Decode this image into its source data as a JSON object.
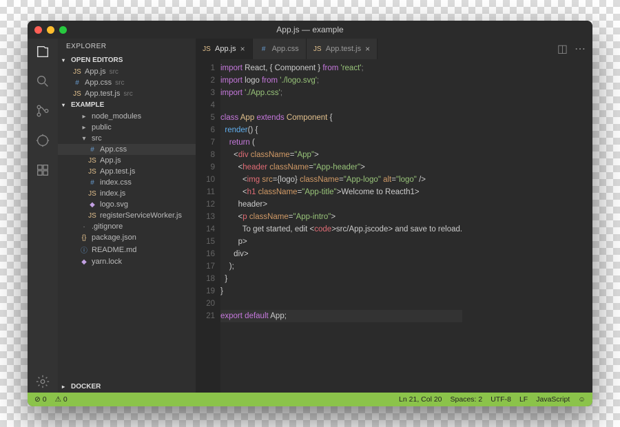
{
  "title": "App.js — example",
  "sidebar": {
    "title": "EXPLORER",
    "open_editors": {
      "label": "OPEN EDITORS",
      "items": [
        {
          "icon": "JS",
          "cls": "js",
          "name": "App.js",
          "meta": "src"
        },
        {
          "icon": "#",
          "cls": "css",
          "name": "App.css",
          "meta": "src"
        },
        {
          "icon": "JS",
          "cls": "js",
          "name": "App.test.js",
          "meta": "src"
        }
      ]
    },
    "project": {
      "label": "EXAMPLE",
      "tree": [
        {
          "icon": "▸",
          "cls": "txt",
          "name": "node_modules",
          "ind": "sub"
        },
        {
          "icon": "▸",
          "cls": "txt",
          "name": "public",
          "ind": "sub"
        },
        {
          "icon": "▾",
          "cls": "txt",
          "name": "src",
          "ind": "sub"
        },
        {
          "icon": "#",
          "cls": "css",
          "name": "App.css",
          "ind": "sub2",
          "sel": true
        },
        {
          "icon": "JS",
          "cls": "js",
          "name": "App.js",
          "ind": "sub2"
        },
        {
          "icon": "JS",
          "cls": "js",
          "name": "App.test.js",
          "ind": "sub2"
        },
        {
          "icon": "#",
          "cls": "css",
          "name": "index.css",
          "ind": "sub2"
        },
        {
          "icon": "JS",
          "cls": "js",
          "name": "index.js",
          "ind": "sub2"
        },
        {
          "icon": "◆",
          "cls": "svg",
          "name": "logo.svg",
          "ind": "sub2"
        },
        {
          "icon": "JS",
          "cls": "js",
          "name": "registerServiceWorker.js",
          "ind": "sub2"
        },
        {
          "icon": "·",
          "cls": "txt",
          "name": ".gitignore",
          "ind": "sub"
        },
        {
          "icon": "{}",
          "cls": "json",
          "name": "package.json",
          "ind": "sub"
        },
        {
          "icon": "ⓘ",
          "cls": "md",
          "name": "README.md",
          "ind": "sub"
        },
        {
          "icon": "◆",
          "cls": "svg",
          "name": "yarn.lock",
          "ind": "sub"
        }
      ]
    },
    "docker": "DOCKER"
  },
  "tabs": [
    {
      "icon": "JS",
      "cls": "js",
      "name": "App.js",
      "close": true,
      "active": true
    },
    {
      "icon": "#",
      "cls": "css",
      "name": "App.css",
      "close": false
    },
    {
      "icon": "JS",
      "cls": "js",
      "name": "App.test.js",
      "close": true
    }
  ],
  "code": {
    "lines": [
      [
        [
          "kw",
          "import"
        ],
        [
          "",
          " React, { Component } "
        ],
        [
          "kw",
          "from"
        ],
        [
          "",
          " "
        ],
        [
          "str",
          "'react'"
        ],
        [
          "pn",
          ";"
        ]
      ],
      [
        [
          "kw",
          "import"
        ],
        [
          "",
          " logo "
        ],
        [
          "kw",
          "from"
        ],
        [
          "",
          " "
        ],
        [
          "str",
          "'./logo.svg'"
        ],
        [
          "pn",
          ";"
        ]
      ],
      [
        [
          "kw",
          "import"
        ],
        [
          "",
          " "
        ],
        [
          "str",
          "'./App.css'"
        ],
        [
          "pn",
          ";"
        ]
      ],
      [],
      [
        [
          "kw",
          "class"
        ],
        [
          "",
          " "
        ],
        [
          "cmp",
          "App"
        ],
        [
          "",
          " "
        ],
        [
          "kw",
          "extends"
        ],
        [
          "",
          " "
        ],
        [
          "cmp",
          "Component"
        ],
        [
          "",
          " {"
        ]
      ],
      [
        [
          "",
          "  "
        ],
        [
          "fn",
          "render"
        ],
        [
          "",
          "() {"
        ]
      ],
      [
        [
          "",
          "    "
        ],
        [
          "kw",
          "return"
        ],
        [
          "",
          " ("
        ]
      ],
      [
        [
          "",
          "      <"
        ],
        [
          "tag",
          "div"
        ],
        [
          "",
          " "
        ],
        [
          "attr",
          "className"
        ],
        [
          "",
          "="
        ],
        [
          "str",
          "\"App\""
        ],
        [
          "",
          ">"
        ]
      ],
      [
        [
          "",
          "        <"
        ],
        [
          "tag",
          "header"
        ],
        [
          "",
          " "
        ],
        [
          "attr",
          "className"
        ],
        [
          "",
          "="
        ],
        [
          "str",
          "\"App-header\""
        ],
        [
          "",
          ">"
        ]
      ],
      [
        [
          "",
          "          <"
        ],
        [
          "tag",
          "img"
        ],
        [
          "",
          " "
        ],
        [
          "attr",
          "src"
        ],
        [
          "",
          "={logo} "
        ],
        [
          "attr",
          "className"
        ],
        [
          "",
          "="
        ],
        [
          "str",
          "\"App-logo\""
        ],
        [
          "",
          " "
        ],
        [
          "attr",
          "alt"
        ],
        [
          "",
          "="
        ],
        [
          "str",
          "\"logo\""
        ],
        [
          "",
          " />"
        ]
      ],
      [
        [
          "",
          "          <"
        ],
        [
          "tag",
          "h1"
        ],
        [
          "",
          " "
        ],
        [
          "attr",
          "className"
        ],
        [
          "",
          "="
        ],
        [
          "str",
          "\"App-title\""
        ],
        [
          "",
          ">Welcome to React</"
        ],
        [
          "tag",
          "h1"
        ],
        [
          "",
          ">"
        ]
      ],
      [
        [
          "",
          "        </"
        ],
        [
          "tag",
          "header"
        ],
        [
          "",
          ">"
        ]
      ],
      [
        [
          "",
          "        <"
        ],
        [
          "tag",
          "p"
        ],
        [
          "",
          " "
        ],
        [
          "attr",
          "className"
        ],
        [
          "",
          "="
        ],
        [
          "str",
          "\"App-intro\""
        ],
        [
          "",
          ">"
        ]
      ],
      [
        [
          "",
          "          To get started, edit <"
        ],
        [
          "tag",
          "code"
        ],
        [
          "",
          ">src/App.js</"
        ],
        [
          "tag",
          "code"
        ],
        [
          "",
          "> and save to reload."
        ]
      ],
      [
        [
          "",
          "        </"
        ],
        [
          "tag",
          "p"
        ],
        [
          "",
          ">"
        ]
      ],
      [
        [
          "",
          "      </"
        ],
        [
          "tag",
          "div"
        ],
        [
          "",
          ">"
        ]
      ],
      [
        [
          "",
          "    );"
        ]
      ],
      [
        [
          "",
          "  }"
        ]
      ],
      [
        [
          "",
          "}"
        ]
      ],
      [],
      [
        [
          "kw",
          "export"
        ],
        [
          "",
          " "
        ],
        [
          "kw",
          "default"
        ],
        [
          "",
          " App;"
        ]
      ]
    ],
    "highlight": 21
  },
  "status": {
    "errors": "⊘ 0",
    "warnings": "⚠ 0",
    "pos": "Ln 21, Col 20",
    "spaces": "Spaces: 2",
    "enc": "UTF-8",
    "eol": "LF",
    "lang": "JavaScript",
    "smile": "☺"
  }
}
